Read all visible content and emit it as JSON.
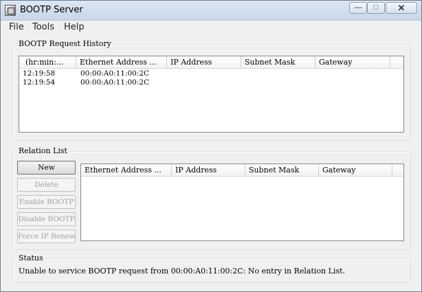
{
  "window": {
    "title": "BOOTP Server"
  },
  "titlebar_buttons": {
    "minimize": "—",
    "maximize": "□",
    "close": "✕"
  },
  "menu": {
    "file": "File",
    "tools": "Tools",
    "help": "Help"
  },
  "history": {
    "label": "BOOTP Request History",
    "columns": [
      "(hr:min:...",
      "Ethernet Address ...",
      "IP Address",
      "Subnet Mask",
      "Gateway"
    ],
    "rows": [
      {
        "time": "12:19:58",
        "mac": "00:00:A0:11:00:2C"
      },
      {
        "time": "12:19:54",
        "mac": "00:00:A0:11:00:2C"
      }
    ]
  },
  "relation": {
    "label": "Relation List",
    "buttons": {
      "new": "New",
      "delete": "Delete",
      "enable": "Enable BOOTP",
      "disable": "Disable BOOTP",
      "force": "Force IP Renew"
    },
    "columns": [
      "Ethernet Address ...",
      "IP Address",
      "Subnet Mask",
      "Gateway"
    ]
  },
  "status": {
    "label": "Status",
    "message": "Unable to service BOOTP request from 00:00:A0:11:00:2C:  No entry in Relation List."
  }
}
